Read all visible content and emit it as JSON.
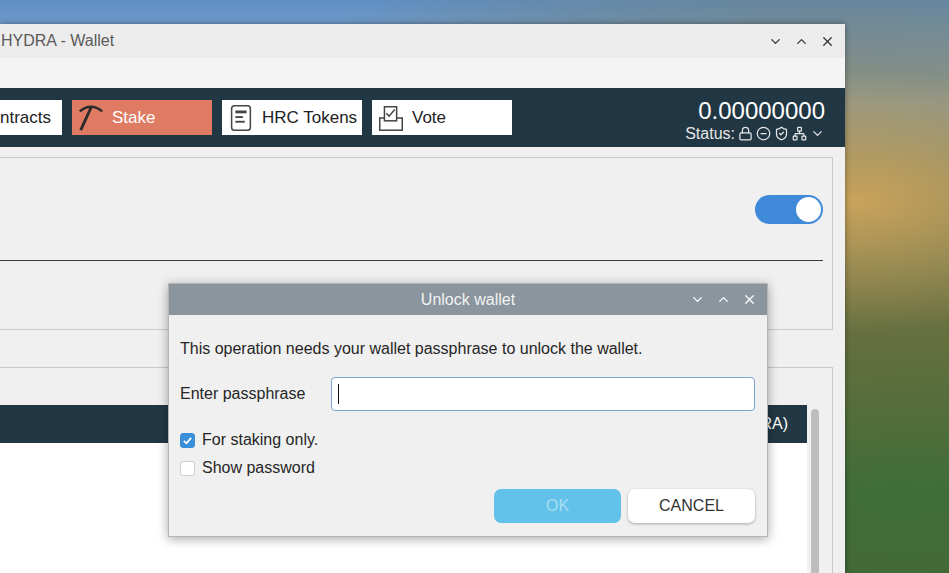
{
  "window": {
    "title": "HYDRA - Wallet"
  },
  "tabs": [
    {
      "label": "ntracts",
      "selected": false
    },
    {
      "label": "Stake",
      "selected": true
    },
    {
      "label": "HRC Tokens",
      "selected": false
    },
    {
      "label": "Vote",
      "selected": false
    }
  ],
  "balance": {
    "amount": "0.00000000",
    "status_label": "Status:"
  },
  "stake_panel": {
    "toggle_on": true
  },
  "table": {
    "header_text": "RA)"
  },
  "dialog": {
    "title": "Unlock wallet",
    "message": "This operation needs your wallet passphrase to unlock the wallet.",
    "field": {
      "label": "Enter passphrase",
      "value": "",
      "focused": true
    },
    "checkboxes": [
      {
        "label": "For staking only.",
        "checked": true
      },
      {
        "label": "Show password",
        "checked": false
      }
    ],
    "buttons": [
      {
        "label": "OK",
        "disabled": true
      },
      {
        "label": "CANCEL",
        "disabled": false
      }
    ]
  }
}
